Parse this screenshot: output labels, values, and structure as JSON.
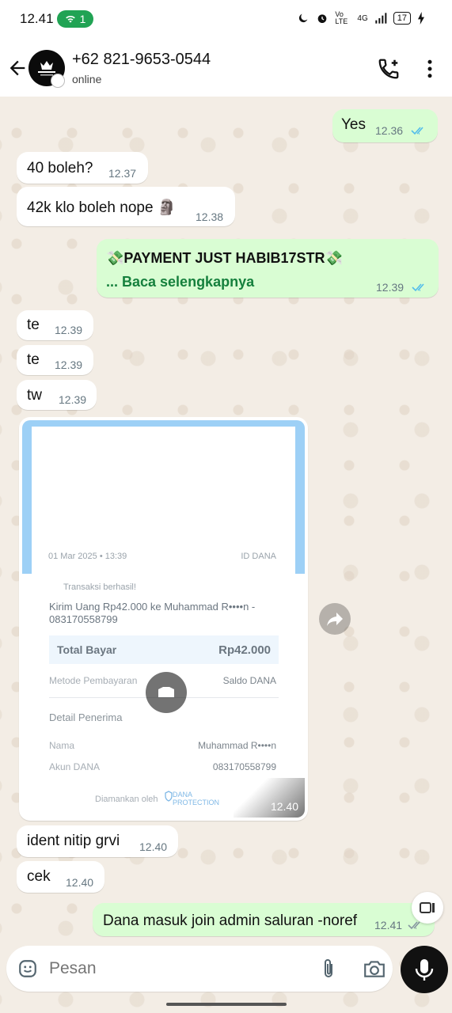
{
  "status_bar": {
    "time": "12.41",
    "call_count": "1",
    "network": "Vo LTE",
    "signal": "4G",
    "battery": "17"
  },
  "header": {
    "contact_name": "+62 821-9653-0544",
    "contact_status": "online"
  },
  "messages": [
    {
      "dir": "out",
      "text": "Yes",
      "time": "12.36"
    },
    {
      "dir": "in",
      "text": "40 boleh?",
      "time": "12.37"
    },
    {
      "dir": "in",
      "text": "42k klo boleh nope 🗿",
      "time": "12.38"
    },
    {
      "dir": "out",
      "text": "💸PAYMENT JUST HABIB17STR💸",
      "read_more": "... Baca selengkapnya",
      "time": "12.39"
    },
    {
      "dir": "in",
      "text": "te",
      "time": "12.39"
    },
    {
      "dir": "in",
      "text": "te",
      "time": "12.39"
    },
    {
      "dir": "in",
      "text": "tw",
      "time": "12.39"
    },
    {
      "dir": "in",
      "time": "12.40"
    },
    {
      "dir": "in",
      "text": "ident nitip grvi",
      "time": "12.40"
    },
    {
      "dir": "in",
      "text": "cek",
      "time": "12.40"
    },
    {
      "dir": "out",
      "text": "Dana masuk join admin saluran -noref",
      "time": "12.41"
    }
  ],
  "receipt": {
    "date": "01 Mar 2025 • 13:39",
    "id_label": "ID DANA",
    "status": "Transaksi berhasil!",
    "description": "Kirim Uang Rp42.000 ke Muhammad R••••n - 083170558799",
    "total_label": "Total Bayar",
    "total_value": "Rp42.000",
    "method_label": "Metode Pembayaran",
    "method_value": "Saldo DANA",
    "recipient_section": "Detail Penerima",
    "name_label": "Nama",
    "name_value": "Muhammad R••••n",
    "account_label": "Akun DANA",
    "account_value": "083170558799",
    "footer": "Diamankan oleh",
    "protection_brand": "DANA PROTECTION"
  },
  "input": {
    "placeholder": "Pesan"
  },
  "colors": {
    "outgoing_bubble": "#d9fdd3",
    "incoming_bubble": "#ffffff",
    "read_ticks": "#53bdeb",
    "read_more": "#15803d",
    "chat_background": "#f3ede5"
  },
  "icons": [
    "back-arrow-icon",
    "add-call-icon",
    "more-vert-icon",
    "double-check-icon",
    "forward-icon",
    "play-icon",
    "sticker-icon",
    "attach-icon",
    "camera-icon",
    "mic-icon"
  ]
}
